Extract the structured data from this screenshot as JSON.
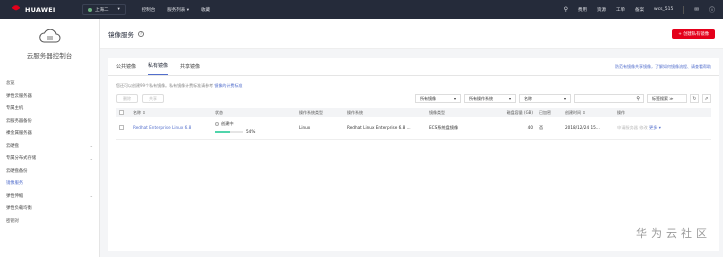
{
  "topbar": {
    "brand": "HUAWEI",
    "region": "上海二",
    "nav": [
      "控制台",
      "服务列表 ▾",
      "收藏"
    ],
    "right": [
      "费用",
      "资源",
      "工单",
      "备案",
      "wcs_515"
    ]
  },
  "sidebar": {
    "title": "云服务器控制台",
    "items": [
      {
        "label": "总览",
        "chevron": false,
        "active": false
      },
      {
        "label": "弹性云服务器",
        "chevron": false,
        "active": false
      },
      {
        "label": "专属主机",
        "chevron": false,
        "active": false
      },
      {
        "label": "云服务器备份",
        "chevron": false,
        "active": false
      },
      {
        "label": "裸金属服务器",
        "chevron": false,
        "active": false
      },
      {
        "label": "云硬盘",
        "chevron": true,
        "active": false
      },
      {
        "label": "专属分布式存储",
        "chevron": true,
        "active": false
      },
      {
        "label": "云硬盘备份",
        "chevron": false,
        "active": false
      },
      {
        "label": "镜像服务",
        "chevron": false,
        "active": true
      },
      {
        "label": "弹性伸缩",
        "chevron": true,
        "active": false
      },
      {
        "label": "弹性负载均衡",
        "chevron": false,
        "active": false
      },
      {
        "label": "密钥对",
        "chevron": false,
        "active": false
      }
    ]
  },
  "page": {
    "title": "镜像服务",
    "create_button": "+ 创建私有镜像"
  },
  "tabs": [
    "公共镜像",
    "私有镜像",
    "共享镜像"
  ],
  "active_tab": 1,
  "tab_right_link": "防范有镜像共享镜像，了解如何镜像流程、请查看帮助",
  "tip": {
    "text": "您还可以创建99个私有镜像。私有镜像计费标准请参考 ",
    "link": "镜像的计费标准"
  },
  "toolbar": {
    "delete": "删除",
    "share": "共享",
    "filter_image": "所有镜像",
    "filter_os": "所有操作系统",
    "filter_name": "名称",
    "tag_search": "标签搜索 ≫"
  },
  "table": {
    "headers": [
      "名称 ⇕",
      "状态",
      "操作系统类型",
      "操作系统",
      "镜像类型",
      "磁盘容量 (GB)",
      "已加密",
      "创建时间 ⇕",
      "操作"
    ],
    "rows": [
      {
        "name": "Redhat Enterprise Linux 6.8",
        "status": "创建中",
        "progress_pct": 54,
        "progress_label": "54%",
        "os_type": "Linux",
        "os": "Redhat Linux Enterprise 6.8 ...",
        "image_type": "ECS系统盘镜像",
        "disk": "40",
        "encrypted": "否",
        "created": "2018/12/24 15...",
        "ops": [
          "申请服务器",
          "修改",
          "更多 ▾"
        ]
      }
    ]
  },
  "watermark": "华为云社区",
  "colors": {
    "topbar": "#252b3a",
    "accent": "#526ecc",
    "brand_red": "#e4001b",
    "progress": "#50d4ab"
  }
}
